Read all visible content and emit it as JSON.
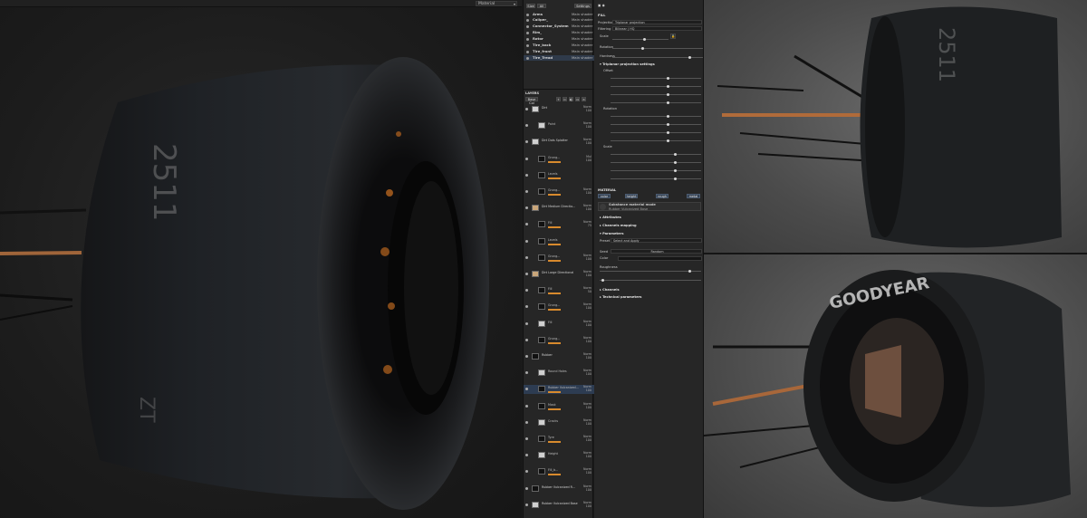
{
  "viewport": {
    "mode_label": "Material"
  },
  "texture_sets": {
    "toolbar": {
      "size_btn": "Size",
      "all_btn": "All",
      "settings_btn": "Settings"
    },
    "items": [
      {
        "name": "Arms",
        "shader": "Main shader"
      },
      {
        "name": "Caliper_",
        "shader": "Main shader"
      },
      {
        "name": "Connector_System",
        "shader": "Main shader"
      },
      {
        "name": "Rim_",
        "shader": "Main shader"
      },
      {
        "name": "Rotor",
        "shader": "Main shader"
      },
      {
        "name": "Tire_back",
        "shader": "Main shader"
      },
      {
        "name": "Tire_front",
        "shader": "Main shader"
      },
      {
        "name": "Tire_Tread",
        "shader": "Main shader"
      }
    ]
  },
  "layers": {
    "header": "LAYERS",
    "channel": "Base Col",
    "rows": [
      {
        "name": "Dirt",
        "blend": "Norm",
        "opacity": "100",
        "thumb": "light",
        "sub": false
      },
      {
        "name": "Paint",
        "blend": "Norm",
        "opacity": "100",
        "thumb": "light",
        "sub": true
      },
      {
        "name": "Dirt Dots Splatter",
        "blend": "Norm",
        "opacity": "100",
        "thumb": "light",
        "sub": false
      },
      {
        "name": "Grung...",
        "blend": "Mul",
        "opacity": "100",
        "thumb": "dark",
        "sub": true
      },
      {
        "name": "Levels",
        "blend": "",
        "opacity": "",
        "thumb": "dark",
        "sub": true
      },
      {
        "name": "Grung...",
        "blend": "Norm",
        "opacity": "100",
        "thumb": "dark",
        "sub": true
      },
      {
        "name": "Dirt Medium Directio...",
        "blend": "Norm",
        "opacity": "100",
        "thumb": "tan",
        "sub": false
      },
      {
        "name": "Fill",
        "blend": "Norm",
        "opacity": "75",
        "thumb": "dark",
        "sub": true
      },
      {
        "name": "Levels",
        "blend": "",
        "opacity": "",
        "thumb": "dark",
        "sub": true
      },
      {
        "name": "Grung...",
        "blend": "Norm",
        "opacity": "100",
        "thumb": "dark",
        "sub": true
      },
      {
        "name": "Dirt Large Directional",
        "blend": "Norm",
        "opacity": "100",
        "thumb": "tan",
        "sub": false
      },
      {
        "name": "Fill",
        "blend": "Norm",
        "opacity": "50",
        "thumb": "dark",
        "sub": true
      },
      {
        "name": "Grung...",
        "blend": "Norm",
        "opacity": "100",
        "thumb": "dark",
        "sub": true
      },
      {
        "name": "Fill",
        "blend": "Norm",
        "opacity": "100",
        "thumb": "light",
        "sub": true
      },
      {
        "name": "Grung...",
        "blend": "Norm",
        "opacity": "100",
        "thumb": "dark",
        "sub": true
      },
      {
        "name": "Rubber",
        "blend": "Norm",
        "opacity": "100",
        "thumb": "dark",
        "sub": false
      },
      {
        "name": "Round Holes",
        "blend": "Norm",
        "opacity": "100",
        "thumb": "light",
        "sub": true
      },
      {
        "name": "Rubber Vulcanized...",
        "blend": "Norm",
        "opacity": "100",
        "thumb": "dark",
        "sub": true
      },
      {
        "name": "Mask",
        "blend": "Norm",
        "opacity": "100",
        "thumb": "dark",
        "sub": true
      },
      {
        "name": "Cracks",
        "blend": "Norm",
        "opacity": "100",
        "thumb": "light",
        "sub": true
      },
      {
        "name": "Tyre",
        "blend": "Norm",
        "opacity": "100",
        "thumb": "dark",
        "sub": true
      },
      {
        "name": "Height",
        "blend": "Norm",
        "opacity": "100",
        "thumb": "light",
        "sub": true
      },
      {
        "name": "Fill_b...",
        "blend": "Norm",
        "opacity": "100",
        "thumb": "dark",
        "sub": true
      },
      {
        "name": "Rubber Vulcanized R...",
        "blend": "Norm",
        "opacity": "100",
        "thumb": "dark",
        "sub": false
      },
      {
        "name": "Rubber Vulcanized Base",
        "blend": "Norm",
        "opacity": "100",
        "thumb": "light",
        "sub": false
      }
    ]
  },
  "properties": {
    "title": "FILL",
    "projection_label": "Projection",
    "projection_value": "Triplanar projection",
    "filtering_label": "Filtering",
    "filtering_value": "Bilinear | HQ",
    "scale_label": "Scale",
    "rotation_label": "Rotation",
    "hardness_label": "Hardness",
    "triplanar_section": "Triplanar projection settings",
    "offset_label": "Offset",
    "rotation2_label": "Rotation",
    "scale2_label": "Scale",
    "material_section": "MATERIAL",
    "channels": [
      "color",
      "height",
      "rough",
      "metal"
    ],
    "substance_label": "Substance material mode",
    "substance_value": "Rubber Vulcanized Base",
    "attributes_section": "Attributes",
    "channels_mapping_section": "Channels mapping",
    "parameters_section": "Parameters",
    "preset_label": "Preset",
    "preset_value": "Select and Apply",
    "seed_label": "Seed",
    "seed_value": "Random",
    "color_label": "Color",
    "roughness_label": "Roughness",
    "channels_section": "Channels",
    "technical_section": "Technical parameters"
  },
  "colors": {
    "accent": "#d88a2d",
    "selection": "#2d3c52",
    "panel": "#262626"
  }
}
